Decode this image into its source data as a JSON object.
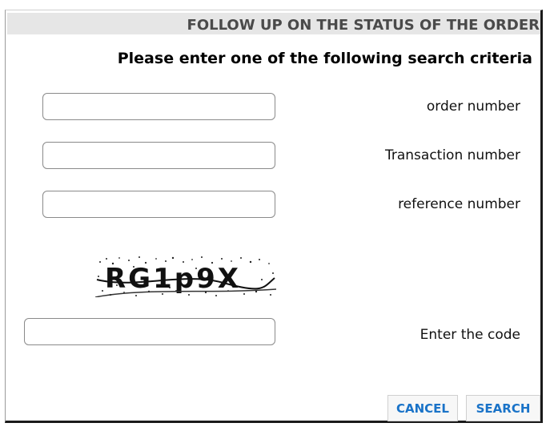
{
  "dialog": {
    "title": "FOLLOW UP ON THE STATUS OF THE ORDER",
    "subtitle": "Please enter one of the following search criteria"
  },
  "fields": {
    "order_number": {
      "label": "order number",
      "value": ""
    },
    "transaction_number": {
      "label": "Transaction number",
      "value": ""
    },
    "reference_number": {
      "label": "reference number",
      "value": ""
    },
    "code": {
      "label": "Enter the code",
      "value": ""
    }
  },
  "captcha": {
    "text": "RG1p9X"
  },
  "buttons": {
    "cancel": "CANCEL",
    "search": "SEARCH"
  },
  "colors": {
    "button_text": "#1a73c8",
    "title_bar": "#e6e6e6"
  }
}
